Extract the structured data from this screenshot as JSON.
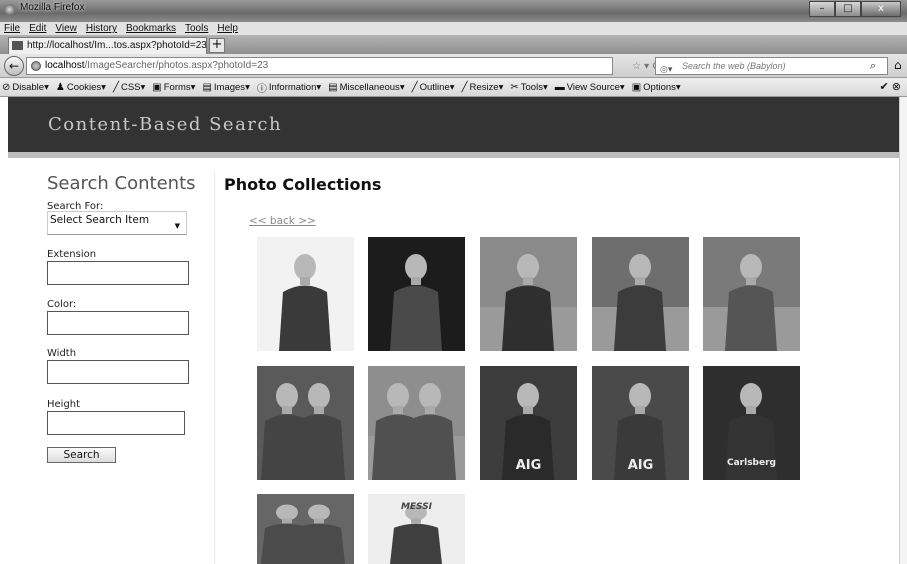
{
  "window": {
    "title": "Mozilla Firefox",
    "controls": [
      "–",
      "□",
      "x"
    ]
  },
  "menu": [
    "File",
    "Edit",
    "View",
    "History",
    "Bookmarks",
    "Tools",
    "Help"
  ],
  "tab": {
    "label": "http://localhost/Im...tos.aspx?photoId=23",
    "new_tab": "+"
  },
  "nav": {
    "url_host": "localhost",
    "url_path": "/ImageSearcher/photos.aspx?photoId=23",
    "search_placeholder": "Search the web (Babylon)"
  },
  "devtoolbar": [
    "Disable",
    "Cookies",
    "CSS",
    "Forms",
    "Images",
    "Information",
    "Miscellaneous",
    "Outline",
    "Resize",
    "Tools",
    "View Source",
    "Options"
  ],
  "header": {
    "title": "Content-Based Search"
  },
  "sidebar": {
    "title": "Search Contents",
    "search_for_label": "Search For:",
    "search_select_value": "Select Search Item",
    "extension_label": "Extension",
    "color_label": "Color:",
    "width_label": "Width",
    "height_label": "Height",
    "search_button": "Search"
  },
  "main": {
    "title": "Photo Collections",
    "back_link": "<< back >>",
    "photos": [
      {
        "text": ""
      },
      {
        "text": ""
      },
      {
        "text": ""
      },
      {
        "text": ""
      },
      {
        "text": ""
      },
      {
        "text": ""
      },
      {
        "text": ""
      },
      {
        "text": "AIG"
      },
      {
        "text": "AIG"
      },
      {
        "text": "Carlsberg"
      },
      {
        "text": ""
      },
      {
        "text": "MESSI"
      }
    ]
  }
}
